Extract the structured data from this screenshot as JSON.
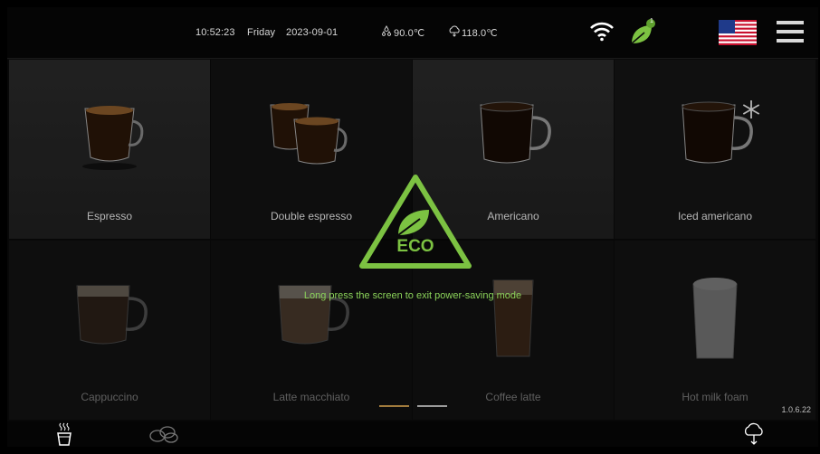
{
  "header": {
    "time": "10:52:23",
    "day": "Friday",
    "date": "2023-09-01",
    "water_temp": "90.0℃",
    "steam_temp": "118.0℃",
    "eco_badge_count": "1",
    "wifi_icon": "wifi-icon",
    "leaf_icon": "leaf-icon",
    "flag_icon": "us-flag-icon",
    "menu_icon": "hamburger-menu-icon"
  },
  "drinks": [
    {
      "label": "Espresso"
    },
    {
      "label": "Double espresso"
    },
    {
      "label": "Americano"
    },
    {
      "label": "Iced americano",
      "badge_icon": "snowflake-icon"
    },
    {
      "label": "Cappuccino"
    },
    {
      "label": "Latte macchiato"
    },
    {
      "label": "Coffee latte"
    },
    {
      "label": "Hot milk foam"
    }
  ],
  "eco": {
    "label": "ECO",
    "message": "Long press the screen to exit power-saving mode",
    "accent_color": "#7cc242"
  },
  "pager": {
    "pages": 2,
    "active_page": 1,
    "active_color": "#a07a3c",
    "inactive_color": "#9a9a9a"
  },
  "version": "1.0.6.22",
  "bottom_bar": {
    "icons": [
      "hot-cup-icon",
      "coffee-beans-icon",
      "steam-cloud-icon"
    ]
  }
}
